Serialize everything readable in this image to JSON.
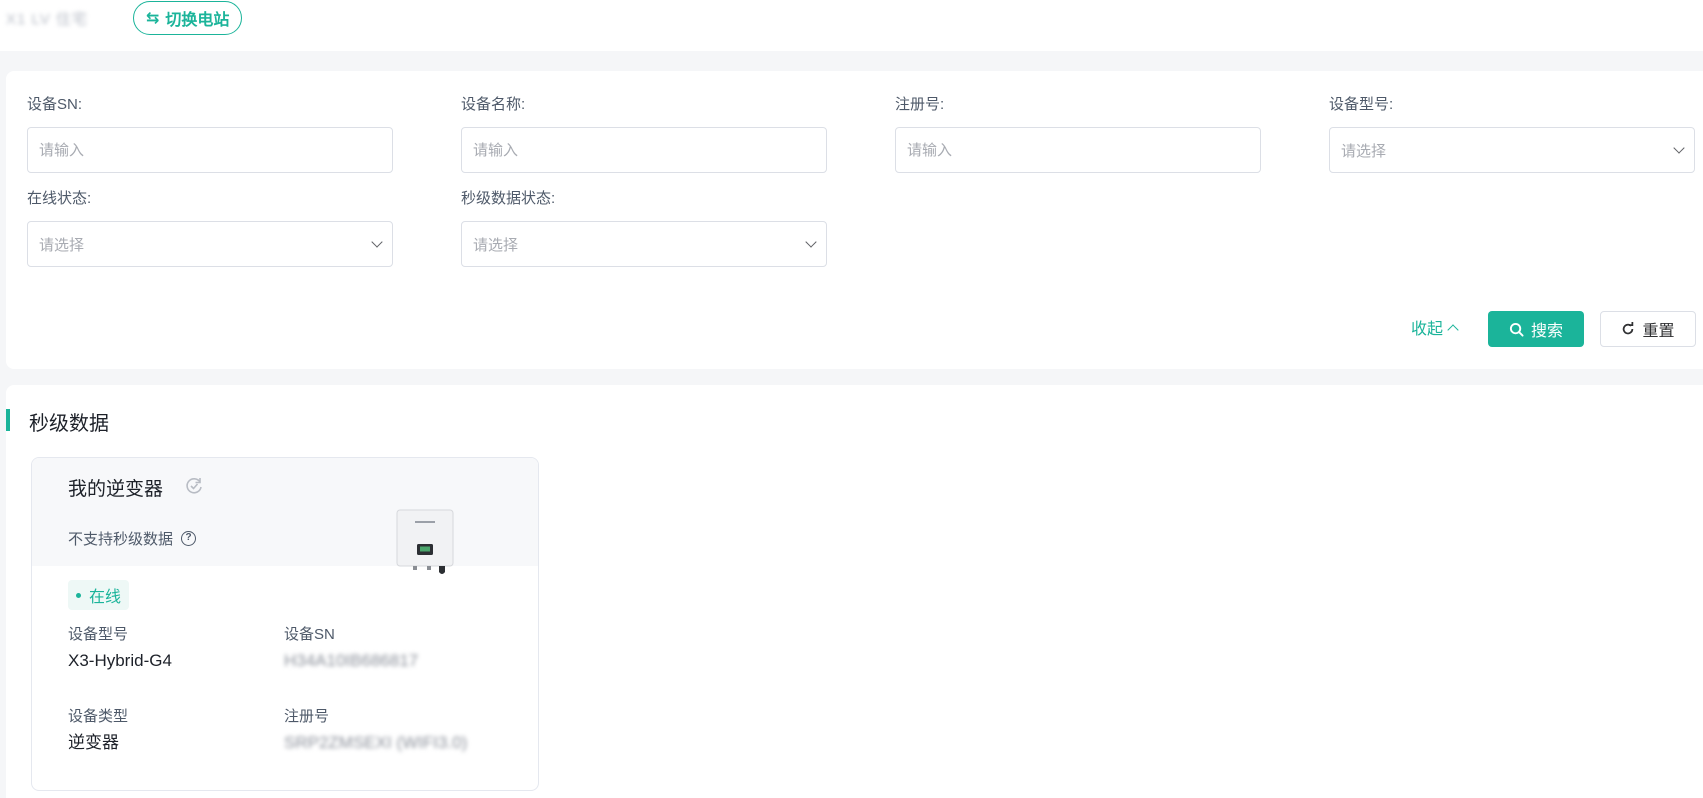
{
  "header": {
    "station_name": "X1 LV 住宅",
    "switch_label": "切换电站"
  },
  "filters": {
    "device_sn": {
      "label": "设备SN:",
      "placeholder": "请输入"
    },
    "device_name": {
      "label": "设备名称:",
      "placeholder": "请输入"
    },
    "reg_no": {
      "label": "注册号:",
      "placeholder": "请输入"
    },
    "device_model": {
      "label": "设备型号:",
      "value": "请选择"
    },
    "online_status": {
      "label": "在线状态:",
      "value": "请选择"
    },
    "second_data_status": {
      "label": "秒级数据状态:",
      "value": "请选择"
    },
    "collapse_label": "收起",
    "search_label": "搜索",
    "reset_label": "重置"
  },
  "section": {
    "title": "秒级数据"
  },
  "device_card": {
    "name": "我的逆变器",
    "support_note": "不支持秒级数据",
    "status": "在线",
    "model_label": "设备型号",
    "model_value": "X3-Hybrid-G4",
    "sn_label": "设备SN",
    "sn_value": "H34A10IB686817",
    "type_label": "设备类型",
    "type_value": "逆变器",
    "reg_label": "注册号",
    "reg_value": "SRP2ZMSEXI (WIFI3.0)"
  },
  "colors": {
    "accent": "#1bb49a",
    "background": "#f5f6f8"
  },
  "icons": {
    "switch": "swap-arrows-icon",
    "sync": "sync-icon",
    "help": "question-circle-icon",
    "search": "search-icon",
    "reset": "refresh-icon"
  }
}
